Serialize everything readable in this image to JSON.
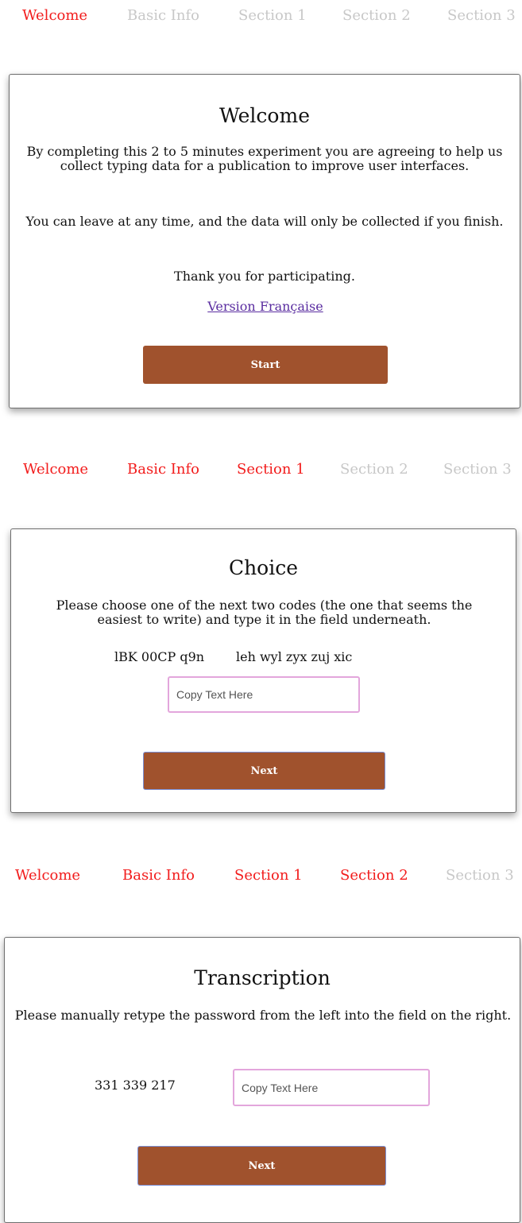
{
  "nav_1": {
    "items": [
      {
        "label": "Welcome",
        "state": "active"
      },
      {
        "label": "Basic Info",
        "state": "inactive"
      },
      {
        "label": "Section 1",
        "state": "inactive"
      },
      {
        "label": "Section 2",
        "state": "inactive"
      },
      {
        "label": "Section 3",
        "state": "inactive"
      }
    ]
  },
  "welcome_card": {
    "title": "Welcome",
    "paragraph_1": "By completing this 2 to 5 minutes experiment you are agreeing to help us collect typing data for a publication to improve user interfaces.",
    "paragraph_2": "You can leave at any time, and the data will only be collected if you finish.",
    "paragraph_3": "Thank you for participating.",
    "language_link": "Version Française",
    "start_button": "Start"
  },
  "nav_2": {
    "items": [
      {
        "label": "Welcome",
        "state": "active"
      },
      {
        "label": "Basic Info",
        "state": "active"
      },
      {
        "label": "Section 1",
        "state": "active"
      },
      {
        "label": "Section 2",
        "state": "inactive"
      },
      {
        "label": "Section 3",
        "state": "inactive"
      }
    ]
  },
  "choice_card": {
    "title": "Choice",
    "instructions": "Please choose one of the next two codes (the one that seems the easiest to write) and type it in the field underneath.",
    "code_1": "lBK 00CP q9n",
    "code_2": "leh wyl zyx zuj xic",
    "input_placeholder": "Copy Text Here",
    "next_button": "Next"
  },
  "nav_3": {
    "items": [
      {
        "label": "Welcome",
        "state": "active"
      },
      {
        "label": "Basic Info",
        "state": "active"
      },
      {
        "label": "Section 1",
        "state": "active"
      },
      {
        "label": "Section 2",
        "state": "active"
      },
      {
        "label": "Section 3",
        "state": "inactive"
      }
    ]
  },
  "transcription_card": {
    "title": "Transcription",
    "instructions": "Please manually retype the password from the left into the field on the right.",
    "password": "331 339 217",
    "input_placeholder": "Copy Text Here",
    "next_button": "Next"
  },
  "colors": {
    "nav_active": "#f21c1c",
    "nav_inactive": "#c8c8c8",
    "button_bg": "#a0522d",
    "input_border": "#e3a6dc",
    "link": "#5a2da0"
  }
}
